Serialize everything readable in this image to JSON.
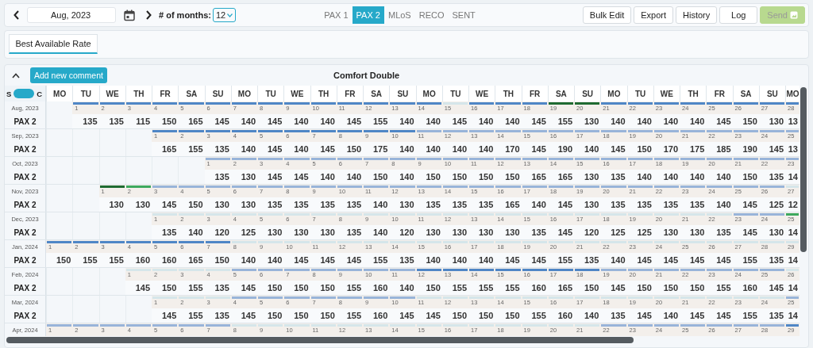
{
  "toolbar": {
    "date": "Aug, 2023",
    "months_label": "# of months:",
    "months_value": "12"
  },
  "tabs": [
    {
      "label": "PAX 1",
      "selected": false
    },
    {
      "label": "PAX 2",
      "selected": true
    },
    {
      "label": "MLoS",
      "selected": false
    },
    {
      "label": "RECO",
      "selected": false
    },
    {
      "label": "SENT",
      "selected": false
    }
  ],
  "actions": [
    {
      "label": "Bulk Edit",
      "disabled": false,
      "kind": "text"
    },
    {
      "label": "Export",
      "disabled": false,
      "kind": "text"
    },
    {
      "label": "History",
      "disabled": false,
      "kind": "text"
    },
    {
      "label": "Log",
      "disabled": false,
      "kind": "text"
    },
    {
      "label": "Send",
      "disabled": true,
      "kind": "send"
    }
  ],
  "rate_tabs": [
    {
      "label": "Best Available Rate",
      "selected": true
    }
  ],
  "section": {
    "title": "Comfort Double",
    "comment_button": "Add new comment",
    "expanded": true
  },
  "toggle": {
    "left": "S",
    "right": "C",
    "on": true
  },
  "weekdays": [
    "MO",
    "TU",
    "WE",
    "TH",
    "FR",
    "SA",
    "SU",
    "MO",
    "TU",
    "WE",
    "TH",
    "FR",
    "SA",
    "SU",
    "MO",
    "TU",
    "WE",
    "TH",
    "FR",
    "SA",
    "SU",
    "MO",
    "TU",
    "WE",
    "TH",
    "FR",
    "SA",
    "SU",
    "MO"
  ],
  "months": [
    {
      "month": "Aug, 2023",
      "row_label": "PAX 2",
      "days": [
        {
          "day": "1",
          "price": "135",
          "color": "#4f86c6"
        },
        {
          "day": "2",
          "price": "135",
          "color": "#4f86c6"
        },
        {
          "day": "3",
          "price": "115",
          "color": "#4f86c6"
        },
        {
          "day": "4",
          "price": "150",
          "color": "#4f86c6"
        },
        {
          "day": "5",
          "price": "165",
          "color": "#4f86c6"
        },
        {
          "day": "6",
          "price": "145",
          "color": "#4f86c6"
        },
        {
          "day": "7",
          "price": "140",
          "color": "#4f86c6"
        },
        {
          "day": "8",
          "price": "145",
          "color": "#4f86c6"
        },
        {
          "day": "9",
          "price": "140",
          "color": "#4f86c6"
        },
        {
          "day": "10",
          "price": "140",
          "color": "#4f86c6"
        },
        {
          "day": "11",
          "price": "145",
          "color": "#4f86c6"
        },
        {
          "day": "12",
          "price": "155",
          "color": "#4f86c6"
        },
        {
          "day": "13",
          "price": "140",
          "color": "#4f86c6"
        },
        {
          "day": "14",
          "price": "140",
          "color": "#4f86c6"
        },
        {
          "day": "15",
          "price": "145",
          "color": "#d5e6ea"
        },
        {
          "day": "16",
          "price": "140",
          "color": "#4f86c6"
        },
        {
          "day": "17",
          "price": "140",
          "color": "#4f86c6"
        },
        {
          "day": "18",
          "price": "145",
          "color": "#4f86c6"
        },
        {
          "day": "19",
          "price": "155",
          "color": "#1f6b32"
        },
        {
          "day": "20",
          "price": "130",
          "color": "#1f6b32"
        },
        {
          "day": "21",
          "price": "140",
          "color": "#4f86c6"
        },
        {
          "day": "22",
          "price": "140",
          "color": "#4f86c6"
        },
        {
          "day": "23",
          "price": "140",
          "color": "#4f86c6"
        },
        {
          "day": "24",
          "price": "140",
          "color": "#4f86c6"
        },
        {
          "day": "25",
          "price": "145",
          "color": "#4f86c6"
        },
        {
          "day": "26",
          "price": "150",
          "color": "#4f86c6"
        },
        {
          "day": "27",
          "price": "130",
          "color": "#4f86c6"
        },
        {
          "day": "28",
          "price": "13",
          "color": "#4f86c6"
        }
      ]
    },
    {
      "month": "Sep, 2023",
      "row_label": "PAX 2",
      "days": [
        {
          "day": "1",
          "price": "165",
          "color": "#4f86c6"
        },
        {
          "day": "2",
          "price": "155",
          "color": "#4f86c6"
        },
        {
          "day": "3",
          "price": "135",
          "color": "#4f86c6"
        },
        {
          "day": "4",
          "price": "140",
          "color": "#4f86c6"
        },
        {
          "day": "5",
          "price": "145",
          "color": "#4f86c6"
        },
        {
          "day": "6",
          "price": "140",
          "color": "#4f86c6"
        },
        {
          "day": "7",
          "price": "145",
          "color": "#4f86c6"
        },
        {
          "day": "8",
          "price": "150",
          "color": "#4f86c6"
        },
        {
          "day": "9",
          "price": "175",
          "color": "#4f86c6"
        },
        {
          "day": "10",
          "price": "140",
          "color": "#4f86c6"
        },
        {
          "day": "11",
          "price": "140",
          "color": "#98b4d9"
        },
        {
          "day": "12",
          "price": "140",
          "color": "#98b4d9"
        },
        {
          "day": "13",
          "price": "140",
          "color": "#98b4d9"
        },
        {
          "day": "14",
          "price": "170",
          "color": "#98b4d9"
        },
        {
          "day": "15",
          "price": "145",
          "color": "#98b4d9"
        },
        {
          "day": "16",
          "price": "190",
          "color": "#98b4d9"
        },
        {
          "day": "17",
          "price": "140",
          "color": "#98b4d9"
        },
        {
          "day": "18",
          "price": "145",
          "color": "#98b4d9"
        },
        {
          "day": "19",
          "price": "150",
          "color": "#98b4d9"
        },
        {
          "day": "20",
          "price": "170",
          "color": "#98b4d9"
        },
        {
          "day": "21",
          "price": "175",
          "color": "#98b4d9"
        },
        {
          "day": "22",
          "price": "185",
          "color": "#98b4d9"
        },
        {
          "day": "23",
          "price": "190",
          "color": "#98b4d9"
        },
        {
          "day": "24",
          "price": "145",
          "color": "#98b4d9"
        },
        {
          "day": "25",
          "price": "13",
          "color": "#98b4d9"
        }
      ]
    },
    {
      "month": "Oct, 2023",
      "row_label": "PAX 2",
      "days": [
        {
          "day": "1",
          "price": "135",
          "color": "#98b4d9"
        },
        {
          "day": "2",
          "price": "130",
          "color": "#98b4d9"
        },
        {
          "day": "3",
          "price": "145",
          "color": "#98b4d9"
        },
        {
          "day": "4",
          "price": "145",
          "color": "#98b4d9"
        },
        {
          "day": "5",
          "price": "140",
          "color": "#98b4d9"
        },
        {
          "day": "6",
          "price": "140",
          "color": "#98b4d9"
        },
        {
          "day": "7",
          "price": "150",
          "color": "#98b4d9"
        },
        {
          "day": "8",
          "price": "140",
          "color": "#98b4d9"
        },
        {
          "day": "9",
          "price": "150",
          "color": "#98b4d9"
        },
        {
          "day": "10",
          "price": "150",
          "color": "#98b4d9"
        },
        {
          "day": "11",
          "price": "150",
          "color": "#98b4d9"
        },
        {
          "day": "12",
          "price": "150",
          "color": "#98b4d9"
        },
        {
          "day": "13",
          "price": "165",
          "color": "#98b4d9"
        },
        {
          "day": "14",
          "price": "165",
          "color": "#98b4d9"
        },
        {
          "day": "15",
          "price": "130",
          "color": "#98b4d9"
        },
        {
          "day": "16",
          "price": "135",
          "color": "#98b4d9"
        },
        {
          "day": "17",
          "price": "140",
          "color": "#98b4d9"
        },
        {
          "day": "18",
          "price": "140",
          "color": "#98b4d9"
        },
        {
          "day": "19",
          "price": "140",
          "color": "#98b4d9"
        },
        {
          "day": "20",
          "price": "140",
          "color": "#98b4d9"
        },
        {
          "day": "21",
          "price": "150",
          "color": "#98b4d9"
        },
        {
          "day": "22",
          "price": "135",
          "color": "#98b4d9"
        },
        {
          "day": "23",
          "price": "14",
          "color": "#98b4d9"
        }
      ]
    },
    {
      "month": "Nov, 2023",
      "row_label": "PAX 2",
      "days": [
        {
          "day": "1",
          "price": "130",
          "color": "#1f6b32"
        },
        {
          "day": "2",
          "price": "130",
          "color": "#3da95e"
        },
        {
          "day": "3",
          "price": "145",
          "color": "#98b4d9"
        },
        {
          "day": "4",
          "price": "150",
          "color": "#98b4d9"
        },
        {
          "day": "5",
          "price": "130",
          "color": "#98b4d9"
        },
        {
          "day": "6",
          "price": "130",
          "color": "#98b4d9"
        },
        {
          "day": "7",
          "price": "135",
          "color": "#98b4d9"
        },
        {
          "day": "8",
          "price": "135",
          "color": "#98b4d9"
        },
        {
          "day": "9",
          "price": "135",
          "color": "#98b4d9"
        },
        {
          "day": "10",
          "price": "135",
          "color": "#98b4d9"
        },
        {
          "day": "11",
          "price": "140",
          "color": "#98b4d9"
        },
        {
          "day": "12",
          "price": "130",
          "color": "#98b4d9"
        },
        {
          "day": "13",
          "price": "135",
          "color": "#98b4d9"
        },
        {
          "day": "14",
          "price": "135",
          "color": "#98b4d9"
        },
        {
          "day": "15",
          "price": "135",
          "color": "#98b4d9"
        },
        {
          "day": "16",
          "price": "165",
          "color": "#98b4d9"
        },
        {
          "day": "17",
          "price": "140",
          "color": "#98b4d9"
        },
        {
          "day": "18",
          "price": "145",
          "color": "#98b4d9"
        },
        {
          "day": "19",
          "price": "130",
          "color": "#98b4d9"
        },
        {
          "day": "20",
          "price": "135",
          "color": "#98b4d9"
        },
        {
          "day": "21",
          "price": "135",
          "color": "#98b4d9"
        },
        {
          "day": "22",
          "price": "135",
          "color": "#98b4d9"
        },
        {
          "day": "23",
          "price": "135",
          "color": "#98b4d9"
        },
        {
          "day": "24",
          "price": "140",
          "color": "#98b4d9"
        },
        {
          "day": "25",
          "price": "145",
          "color": "#98b4d9"
        },
        {
          "day": "26",
          "price": "125",
          "color": "#98b4d9"
        },
        {
          "day": "27",
          "price": "12",
          "color": "#d5e6ea"
        }
      ]
    },
    {
      "month": "Dec, 2023",
      "row_label": "PAX 2",
      "days": [
        {
          "day": "1",
          "price": "135",
          "color": "#d5e6ea"
        },
        {
          "day": "2",
          "price": "140",
          "color": "#d5e6ea"
        },
        {
          "day": "3",
          "price": "120",
          "color": "#d5e6ea"
        },
        {
          "day": "4",
          "price": "125",
          "color": "#d5e6ea"
        },
        {
          "day": "5",
          "price": "130",
          "color": "#d5e6ea"
        },
        {
          "day": "6",
          "price": "130",
          "color": "#d5e6ea"
        },
        {
          "day": "7",
          "price": "130",
          "color": "#d5e6ea"
        },
        {
          "day": "8",
          "price": "135",
          "color": "#d5e6ea"
        },
        {
          "day": "9",
          "price": "140",
          "color": "#d5e6ea"
        },
        {
          "day": "10",
          "price": "120",
          "color": "#d5e6ea"
        },
        {
          "day": "11",
          "price": "130",
          "color": "#d5e6ea"
        },
        {
          "day": "12",
          "price": "130",
          "color": "#d5e6ea"
        },
        {
          "day": "13",
          "price": "130",
          "color": "#d5e6ea"
        },
        {
          "day": "14",
          "price": "130",
          "color": "#d5e6ea"
        },
        {
          "day": "15",
          "price": "135",
          "color": "#d5e6ea"
        },
        {
          "day": "16",
          "price": "145",
          "color": "#d5e6ea"
        },
        {
          "day": "17",
          "price": "120",
          "color": "#d5e6ea"
        },
        {
          "day": "18",
          "price": "125",
          "color": "#d5e6ea"
        },
        {
          "day": "19",
          "price": "125",
          "color": "#d5e6ea"
        },
        {
          "day": "20",
          "price": "130",
          "color": "#d5e6ea"
        },
        {
          "day": "21",
          "price": "130",
          "color": "#d5e6ea"
        },
        {
          "day": "22",
          "price": "135",
          "color": "#d5e6ea"
        },
        {
          "day": "23",
          "price": "145",
          "color": "#98b4d9"
        },
        {
          "day": "24",
          "price": "130",
          "color": "#98b4d9"
        },
        {
          "day": "25",
          "price": "14",
          "color": "#3da95e"
        }
      ]
    },
    {
      "month": "Jan, 2024",
      "row_label": "PAX 2",
      "days": [
        {
          "day": "1",
          "price": "150",
          "color": "#4f86c6"
        },
        {
          "day": "2",
          "price": "155",
          "color": "#4f86c6"
        },
        {
          "day": "3",
          "price": "155",
          "color": "#4f86c6"
        },
        {
          "day": "4",
          "price": "160",
          "color": "#4f86c6"
        },
        {
          "day": "5",
          "price": "160",
          "color": "#4f86c6"
        },
        {
          "day": "6",
          "price": "165",
          "color": "#4f86c6"
        },
        {
          "day": "7",
          "price": "150",
          "color": "#4f86c6"
        },
        {
          "day": "8",
          "price": "140",
          "color": "#d5e6ea"
        },
        {
          "day": "9",
          "price": "140",
          "color": "#d5e6ea"
        },
        {
          "day": "10",
          "price": "145",
          "color": "#d5e6ea"
        },
        {
          "day": "11",
          "price": "145",
          "color": "#d5e6ea"
        },
        {
          "day": "12",
          "price": "145",
          "color": "#d5e6ea"
        },
        {
          "day": "13",
          "price": "155",
          "color": "#d5e6ea"
        },
        {
          "day": "14",
          "price": "135",
          "color": "#d5e6ea"
        },
        {
          "day": "15",
          "price": "140",
          "color": "#d5e6ea"
        },
        {
          "day": "16",
          "price": "140",
          "color": "#d5e6ea"
        },
        {
          "day": "17",
          "price": "140",
          "color": "#d5e6ea"
        },
        {
          "day": "18",
          "price": "145",
          "color": "#d5e6ea"
        },
        {
          "day": "19",
          "price": "145",
          "color": "#d5e6ea"
        },
        {
          "day": "20",
          "price": "155",
          "color": "#d5e6ea"
        },
        {
          "day": "21",
          "price": "135",
          "color": "#d5e6ea"
        },
        {
          "day": "22",
          "price": "140",
          "color": "#d5e6ea"
        },
        {
          "day": "23",
          "price": "145",
          "color": "#d5e6ea"
        },
        {
          "day": "24",
          "price": "145",
          "color": "#d5e6ea"
        },
        {
          "day": "25",
          "price": "145",
          "color": "#d5e6ea"
        },
        {
          "day": "26",
          "price": "145",
          "color": "#d5e6ea"
        },
        {
          "day": "27",
          "price": "155",
          "color": "#d5e6ea"
        },
        {
          "day": "28",
          "price": "135",
          "color": "#d5e6ea"
        },
        {
          "day": "29",
          "price": "14",
          "color": "#d5e6ea"
        }
      ]
    },
    {
      "month": "Feb, 2024",
      "row_label": "PAX 2",
      "days": [
        {
          "day": "1",
          "price": "145",
          "color": "#d5e6ea"
        },
        {
          "day": "2",
          "price": "150",
          "color": "#d5e6ea"
        },
        {
          "day": "3",
          "price": "155",
          "color": "#d5e6ea"
        },
        {
          "day": "4",
          "price": "135",
          "color": "#d5e6ea"
        },
        {
          "day": "5",
          "price": "145",
          "color": "#98b4d9"
        },
        {
          "day": "6",
          "price": "150",
          "color": "#98b4d9"
        },
        {
          "day": "7",
          "price": "150",
          "color": "#98b4d9"
        },
        {
          "day": "8",
          "price": "150",
          "color": "#98b4d9"
        },
        {
          "day": "9",
          "price": "155",
          "color": "#98b4d9"
        },
        {
          "day": "10",
          "price": "160",
          "color": "#98b4d9"
        },
        {
          "day": "11",
          "price": "140",
          "color": "#98b4d9"
        },
        {
          "day": "12",
          "price": "150",
          "color": "#4f86c6"
        },
        {
          "day": "13",
          "price": "155",
          "color": "#4f86c6"
        },
        {
          "day": "14",
          "price": "155",
          "color": "#4f86c6"
        },
        {
          "day": "15",
          "price": "155",
          "color": "#4f86c6"
        },
        {
          "day": "16",
          "price": "160",
          "color": "#4f86c6"
        },
        {
          "day": "17",
          "price": "165",
          "color": "#4f86c6"
        },
        {
          "day": "18",
          "price": "150",
          "color": "#4f86c6"
        },
        {
          "day": "19",
          "price": "145",
          "color": "#98b4d9"
        },
        {
          "day": "20",
          "price": "150",
          "color": "#98b4d9"
        },
        {
          "day": "21",
          "price": "150",
          "color": "#98b4d9"
        },
        {
          "day": "22",
          "price": "150",
          "color": "#98b4d9"
        },
        {
          "day": "23",
          "price": "155",
          "color": "#98b4d9"
        },
        {
          "day": "24",
          "price": "160",
          "color": "#98b4d9"
        },
        {
          "day": "25",
          "price": "145",
          "color": "#98b4d9"
        },
        {
          "day": "26",
          "price": "14",
          "color": "#d5e6ea"
        }
      ]
    },
    {
      "month": "Mar, 2024",
      "row_label": "PAX 2",
      "days": [
        {
          "day": "1",
          "price": "145",
          "color": "#d5e6ea"
        },
        {
          "day": "2",
          "price": "155",
          "color": "#d5e6ea"
        },
        {
          "day": "3",
          "price": "135",
          "color": "#d5e6ea"
        },
        {
          "day": "4",
          "price": "145",
          "color": "#98b4d9"
        },
        {
          "day": "5",
          "price": "150",
          "color": "#98b4d9"
        },
        {
          "day": "6",
          "price": "150",
          "color": "#98b4d9"
        },
        {
          "day": "7",
          "price": "150",
          "color": "#98b4d9"
        },
        {
          "day": "8",
          "price": "155",
          "color": "#98b4d9"
        },
        {
          "day": "9",
          "price": "160",
          "color": "#98b4d9"
        },
        {
          "day": "10",
          "price": "145",
          "color": "#98b4d9"
        },
        {
          "day": "11",
          "price": "145",
          "color": "#d5e6ea"
        },
        {
          "day": "12",
          "price": "150",
          "color": "#d5e6ea"
        },
        {
          "day": "13",
          "price": "150",
          "color": "#d5e6ea"
        },
        {
          "day": "14",
          "price": "150",
          "color": "#d5e6ea"
        },
        {
          "day": "15",
          "price": "155",
          "color": "#d5e6ea"
        },
        {
          "day": "16",
          "price": "160",
          "color": "#d5e6ea"
        },
        {
          "day": "17",
          "price": "140",
          "color": "#d5e6ea"
        },
        {
          "day": "18",
          "price": "135",
          "color": "#d5e6ea"
        },
        {
          "day": "19",
          "price": "145",
          "color": "#d5e6ea"
        },
        {
          "day": "20",
          "price": "140",
          "color": "#d5e6ea"
        },
        {
          "day": "21",
          "price": "145",
          "color": "#d5e6ea"
        },
        {
          "day": "22",
          "price": "145",
          "color": "#d5e6ea"
        },
        {
          "day": "23",
          "price": "155",
          "color": "#d5e6ea"
        },
        {
          "day": "24",
          "price": "135",
          "color": "#d5e6ea"
        },
        {
          "day": "25",
          "price": "14",
          "color": "#98b4d9"
        }
      ]
    },
    {
      "month": "Apr, 2024",
      "days": [
        {
          "day": "1",
          "color": "#98b4d9"
        },
        {
          "day": "2",
          "color": "#98b4d9"
        },
        {
          "day": "3",
          "color": "#98b4d9"
        },
        {
          "day": "4",
          "color": "#98b4d9"
        },
        {
          "day": "5",
          "color": "#98b4d9"
        },
        {
          "day": "6",
          "color": "#98b4d9"
        },
        {
          "day": "7",
          "color": "#98b4d9"
        },
        {
          "day": "8",
          "color": "#d5e6ea"
        },
        {
          "day": "9",
          "color": "#d5e6ea"
        },
        {
          "day": "10",
          "color": "#d5e6ea"
        },
        {
          "day": "11",
          "color": "#d5e6ea"
        },
        {
          "day": "12",
          "color": "#d5e6ea"
        },
        {
          "day": "13",
          "color": "#d5e6ea"
        },
        {
          "day": "14",
          "color": "#d5e6ea"
        },
        {
          "day": "15",
          "color": "#d5e6ea"
        },
        {
          "day": "16",
          "color": "#d5e6ea"
        },
        {
          "day": "17",
          "color": "#d5e6ea"
        },
        {
          "day": "18",
          "color": "#d5e6ea"
        },
        {
          "day": "19",
          "color": "#d5e6ea"
        },
        {
          "day": "20",
          "color": "#d5e6ea"
        },
        {
          "day": "21",
          "color": "#d5e6ea"
        },
        {
          "day": "22",
          "color": "#98b4d9"
        },
        {
          "day": "23",
          "color": "#98b4d9"
        },
        {
          "day": "24",
          "color": "#98b4d9"
        },
        {
          "day": "25",
          "color": "#98b4d9"
        },
        {
          "day": "26",
          "color": "#98b4d9"
        },
        {
          "day": "27",
          "color": "#98b4d9"
        },
        {
          "day": "28",
          "color": "#98b4d9"
        },
        {
          "day": "29",
          "color": "#4f86c6"
        }
      ]
    }
  ]
}
